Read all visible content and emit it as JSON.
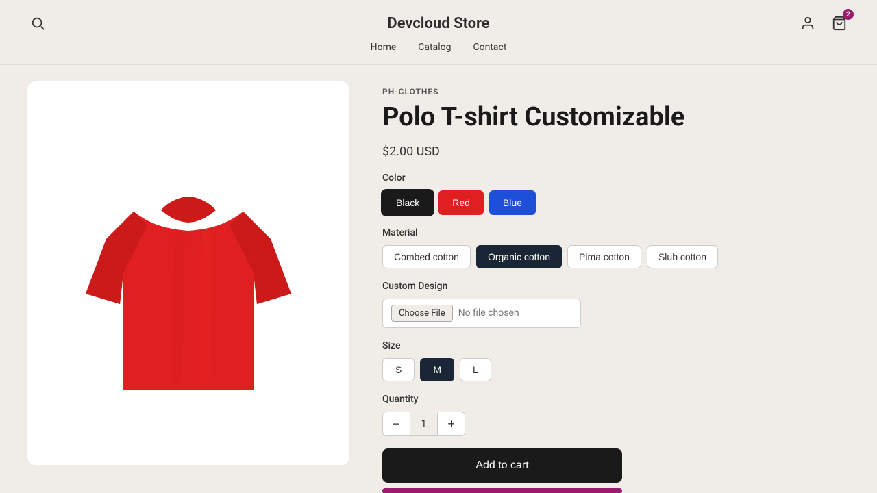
{
  "header": {
    "title": "Devcloud Store",
    "nav": [
      {
        "label": "Home",
        "id": "home"
      },
      {
        "label": "Catalog",
        "id": "catalog"
      },
      {
        "label": "Contact",
        "id": "contact"
      }
    ],
    "cart_count": "2"
  },
  "product": {
    "brand": "PH-CLOTHES",
    "title": "Polo T-shirt Customizable",
    "price": "$2.00 USD",
    "colors": [
      {
        "label": "Black",
        "class": "black",
        "active": true
      },
      {
        "label": "Red",
        "class": "red",
        "active": false
      },
      {
        "label": "Blue",
        "class": "blue",
        "active": false
      }
    ],
    "materials": [
      {
        "label": "Combed cotton",
        "active": false
      },
      {
        "label": "Organic cotton",
        "active": true
      },
      {
        "label": "Pima cotton",
        "active": false
      },
      {
        "label": "Slub cotton",
        "active": false
      }
    ],
    "custom_design_label": "Custom Design",
    "file_input_label": "Choose File",
    "file_input_placeholder": "No file chosen",
    "sizes": [
      {
        "label": "S",
        "active": false
      },
      {
        "label": "M",
        "active": true
      },
      {
        "label": "L",
        "active": false
      }
    ],
    "quantity_label": "Quantity",
    "quantity_value": "1",
    "color_label": "Color",
    "material_label": "Material",
    "size_label": "Size",
    "add_to_cart": "Add to cart"
  }
}
